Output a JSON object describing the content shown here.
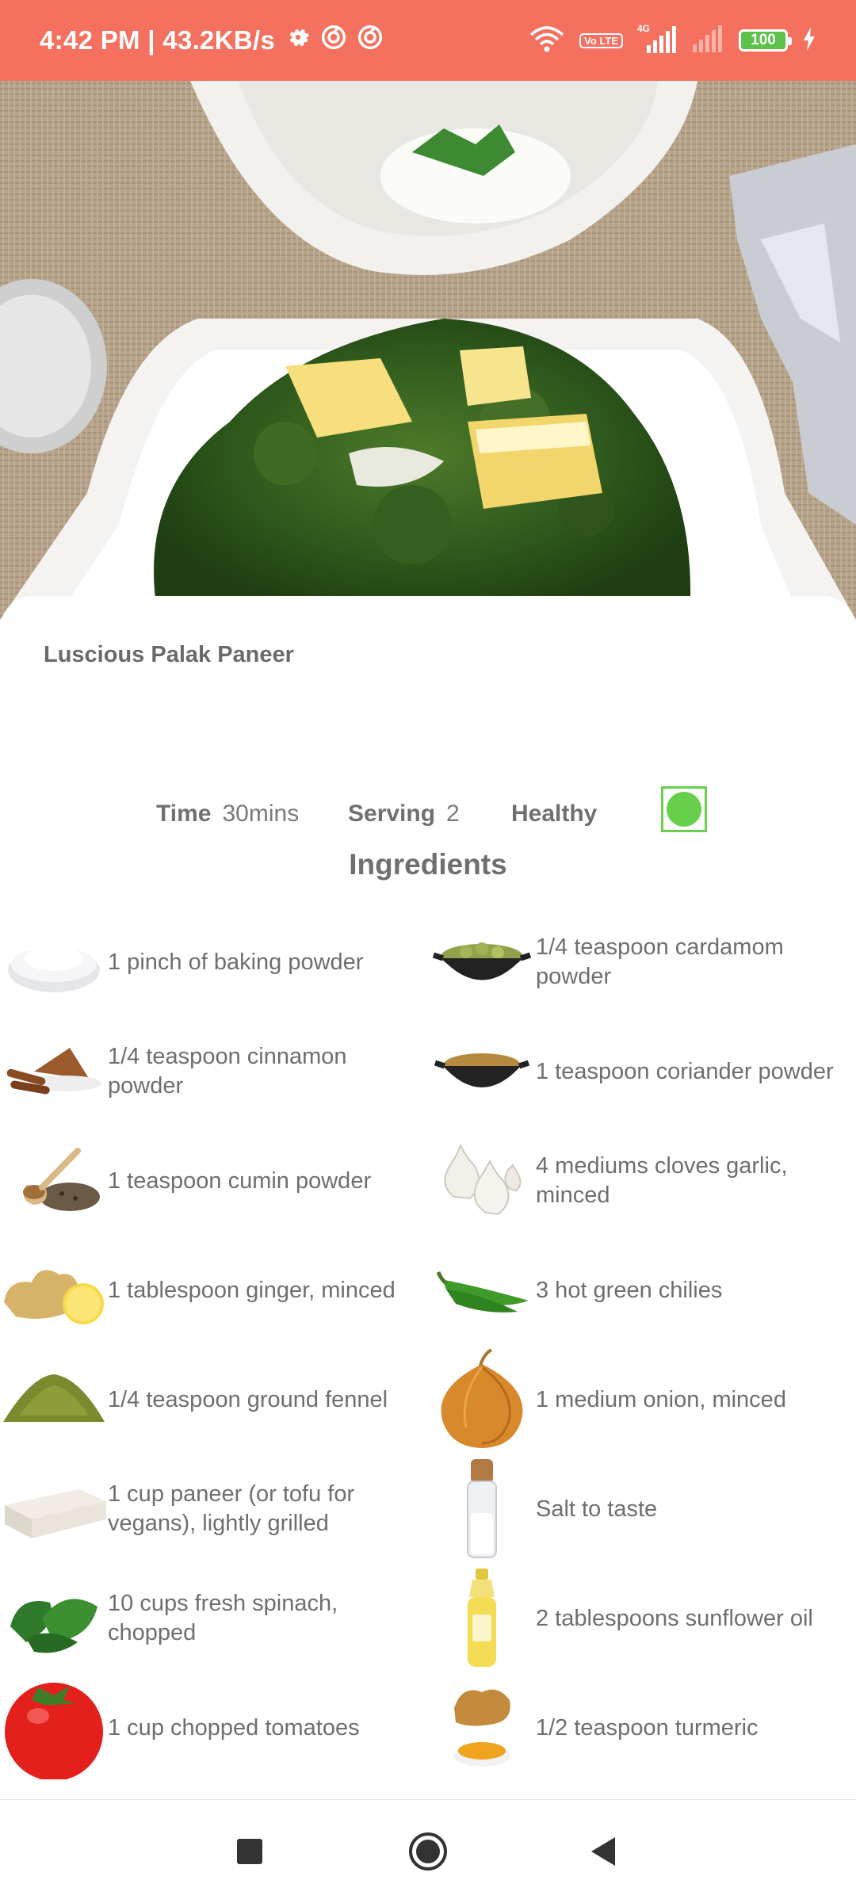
{
  "status_bar": {
    "time_speed": "4:42 PM | 43.2KB/s",
    "network_type": "4G",
    "volte": "Vo LTE",
    "battery_level": "100",
    "icons": [
      "settings-icon",
      "vpn-icon",
      "vpn-icon",
      "wifi-icon",
      "signal-icon",
      "signal-icon",
      "charging-icon"
    ]
  },
  "hero": {
    "image": "palak-paneer-dish-photo"
  },
  "recipe": {
    "title": "Luscious Palak Paneer",
    "time_label": "Time",
    "time_value": "30mins",
    "serving_label": "Serving",
    "serving_value": "2",
    "diet_label": "Healthy",
    "veg_indicator_color": "#66d04a"
  },
  "ingredients_heading": "Ingredients",
  "ingredients": [
    {
      "text": "1 pinch of baking powder",
      "icon": "baking-powder-icon"
    },
    {
      "text": "1/4 teaspoon cardamom powder",
      "icon": "cardamom-icon"
    },
    {
      "text": "1/4 teaspoon cinnamon powder",
      "icon": "cinnamon-icon"
    },
    {
      "text": "1 teaspoon coriander powder",
      "icon": "coriander-icon"
    },
    {
      "text": "1 teaspoon cumin powder",
      "icon": "cumin-icon"
    },
    {
      "text": "4 mediums cloves garlic, minced",
      "icon": "garlic-icon"
    },
    {
      "text": "1 tablespoon ginger, minced",
      "icon": "ginger-icon"
    },
    {
      "text": "3 hot green chilies",
      "icon": "green-chili-icon"
    },
    {
      "text": "1/4 teaspoon ground fennel",
      "icon": "fennel-icon"
    },
    {
      "text": "1 medium onion, minced",
      "icon": "onion-icon"
    },
    {
      "text": "1 cup paneer (or tofu for vegans), lightly grilled",
      "icon": "paneer-icon"
    },
    {
      "text": "Salt to taste",
      "icon": "salt-icon"
    },
    {
      "text": "10 cups fresh spinach, chopped",
      "icon": "spinach-icon"
    },
    {
      "text": "2 tablespoons sunflower oil",
      "icon": "oil-icon"
    },
    {
      "text": "1 cup chopped tomatoes",
      "icon": "tomato-icon"
    },
    {
      "text": "1/2 teaspoon turmeric",
      "icon": "turmeric-icon"
    }
  ],
  "navbar": {
    "icons": [
      "recents-icon",
      "home-icon",
      "back-icon"
    ]
  },
  "colors": {
    "status_bar": "#f47160",
    "text": "#6e6e6e",
    "veg_green": "#66d04a"
  }
}
